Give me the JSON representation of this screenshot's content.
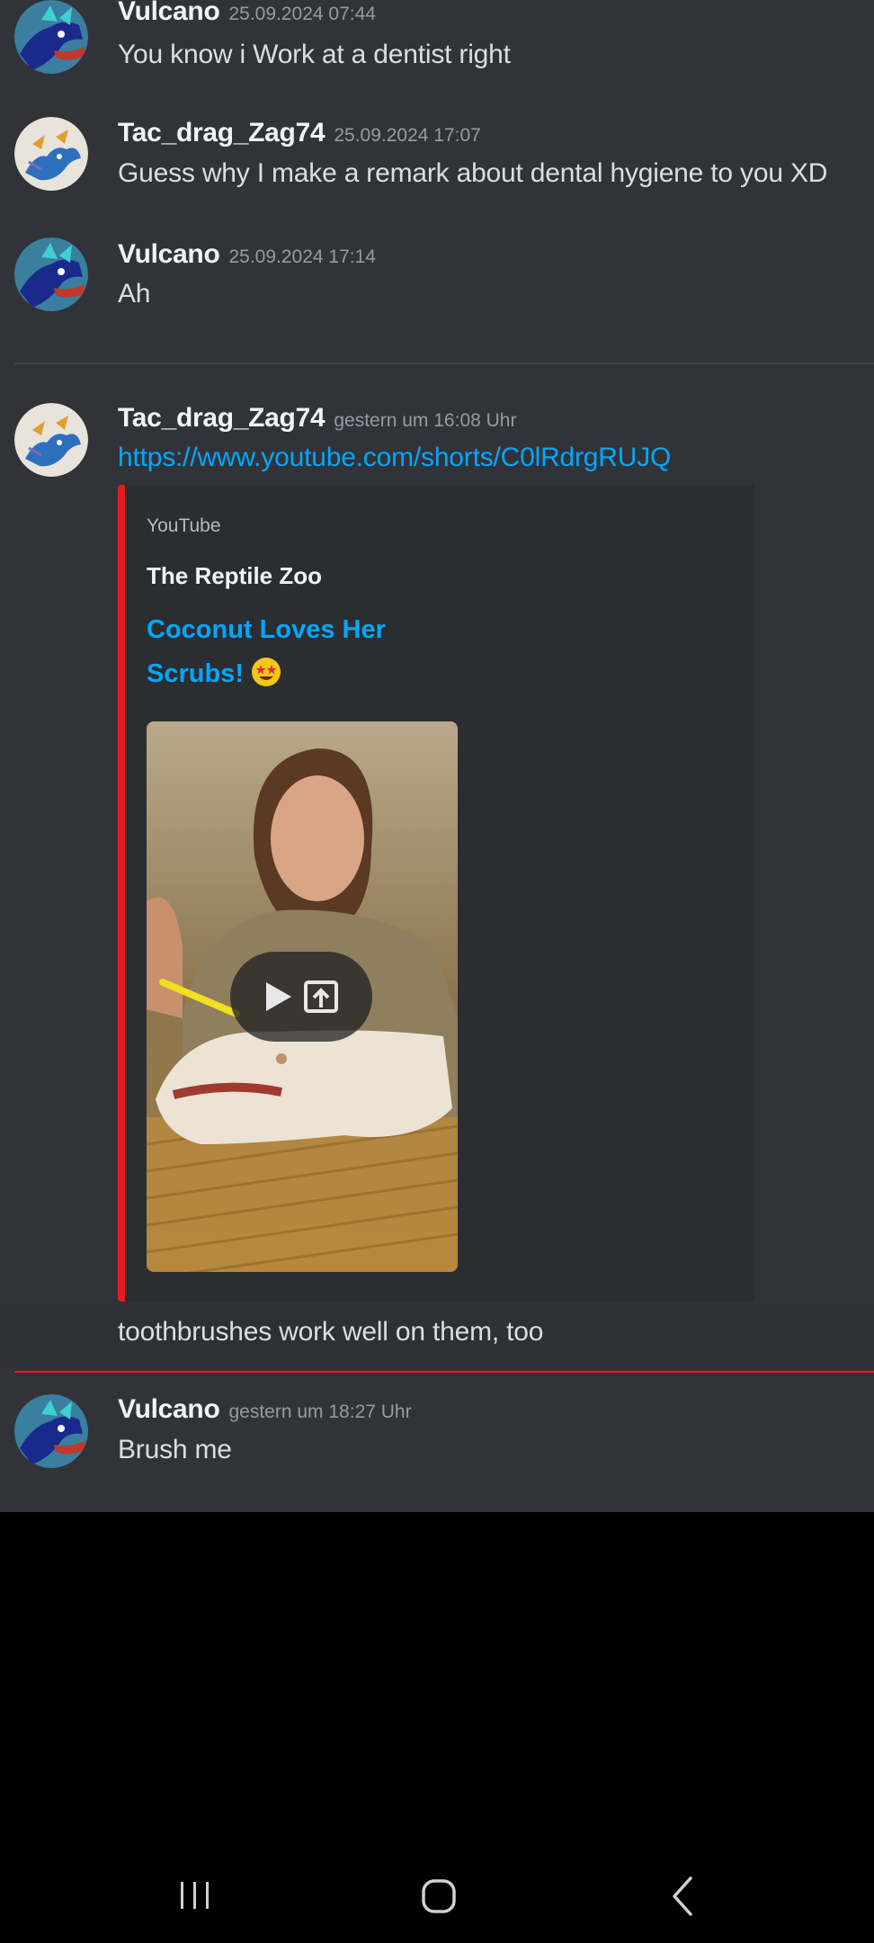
{
  "messages": [
    {
      "author": "Vulcano",
      "timestamp": "25.09.2024 07:44",
      "text": "You know i Work at a dentist right",
      "avatar_icon": "dragon-avatar-icon"
    },
    {
      "author": "Tac_drag_Zag74",
      "timestamp": "25.09.2024 17:07",
      "text": "Guess why I make a remark about dental hygiene to you XD",
      "avatar_icon": "dragon-sketch-avatar-icon"
    },
    {
      "author": "Vulcano",
      "timestamp": "25.09.2024 17:14",
      "text": "Ah",
      "avatar_icon": "dragon-avatar-icon"
    },
    {
      "author": "Tac_drag_Zag74",
      "timestamp": "gestern um 16:08 Uhr",
      "link": "https://www.youtube.com/shorts/C0lRdrgRUJQ",
      "avatar_icon": "dragon-sketch-avatar-icon"
    },
    {
      "text": "toothbrushes work well on them, too"
    },
    {
      "author": "Vulcano",
      "timestamp": "gestern um 18:27 Uhr",
      "text": "Brush me",
      "avatar_icon": "dragon-avatar-icon"
    }
  ],
  "embed": {
    "provider": "YouTube",
    "author": "The Reptile Zoo",
    "title_line1": "Coconut Loves Her",
    "title_line2": "Scrubs!",
    "title_emoji": "star-struck-emoji-icon",
    "accent_color": "#e01e1e",
    "thumbnail_icons": [
      "play-icon",
      "open-external-icon"
    ]
  },
  "colors": {
    "background": "#313338",
    "username": "#f2f3f5",
    "timestamp": "#949ba4",
    "text": "#dbdee1",
    "link": "#00a8fc",
    "new_messages_divider": "#e01e1e"
  },
  "navbar": {
    "icons": [
      "recent-apps-icon",
      "home-icon",
      "back-icon"
    ]
  }
}
